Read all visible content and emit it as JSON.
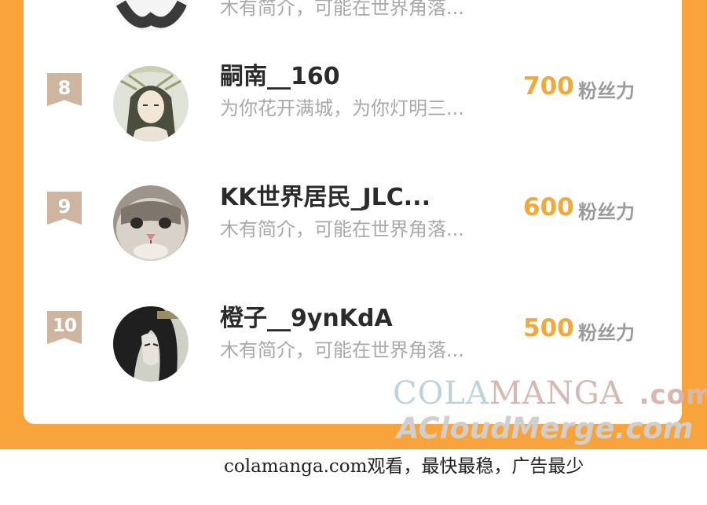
{
  "ranking": {
    "partial_top_row": {
      "bio": "木有简介，可能在世界角落..."
    },
    "rows": [
      {
        "rank": "8",
        "name": "嗣南__160",
        "bio": "为你花开满城，为你灯明三...",
        "score": "700",
        "score_label": "粉丝力",
        "avatar": "anime-character-avatar"
      },
      {
        "rank": "9",
        "name": "KK世界居民_JLC...",
        "bio": "木有简介，可能在世界角落...",
        "score": "600",
        "score_label": "粉丝力",
        "avatar": "cat-avatar"
      },
      {
        "rank": "10",
        "name": "橙子__9ynKdA",
        "bio": "木有简介，可能在世界角落...",
        "score": "500",
        "score_label": "粉丝力",
        "avatar": "dark-hair-character-avatar"
      }
    ]
  },
  "colors": {
    "frame_orange": "#f9a43a",
    "score_orange": "#f2a937",
    "badge_tan": "#ceb5a0",
    "bio_gray": "#a9a9a9"
  },
  "watermark": {
    "line1_a": "COLA",
    "line1_b": "MANGA",
    "line1_c": ".com",
    "line2": "ACloudMerge.com"
  },
  "footer": {
    "text": "colamanga.com观看，最快最稳，广告最少"
  }
}
